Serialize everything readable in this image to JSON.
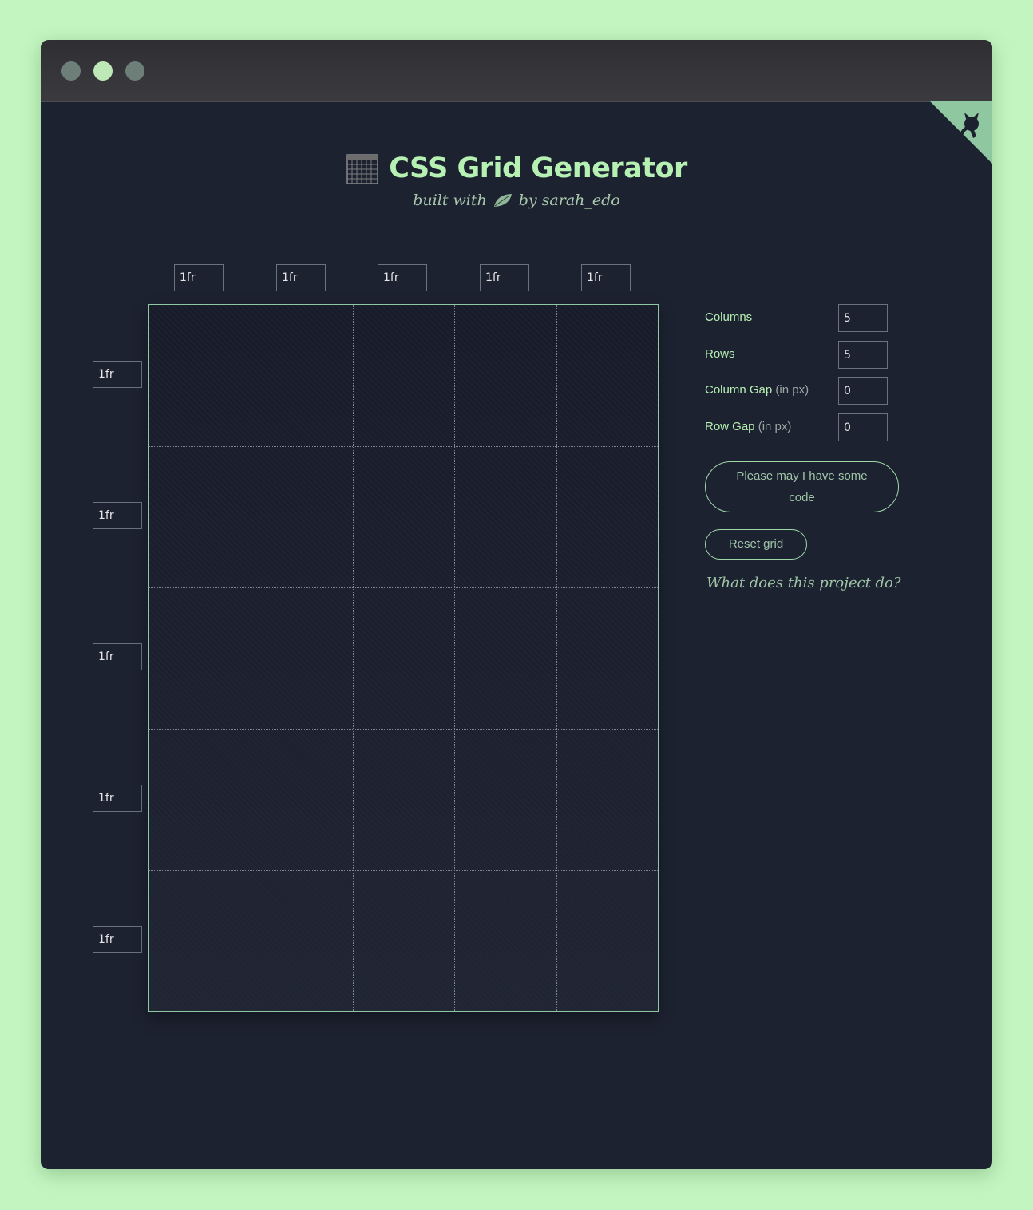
{
  "header": {
    "title": "CSS Grid Generator",
    "subtitle_prefix": "built with",
    "subtitle_suffix": "by sarah_edo"
  },
  "grid": {
    "columns": [
      "1fr",
      "1fr",
      "1fr",
      "1fr",
      "1fr"
    ],
    "rows": [
      "1fr",
      "1fr",
      "1fr",
      "1fr",
      "1fr"
    ]
  },
  "controls": {
    "columns_label": "Columns",
    "columns_value": "5",
    "rows_label": "Rows",
    "rows_value": "5",
    "column_gap_label": "Column Gap",
    "column_gap_unit": "(in px)",
    "column_gap_value": "0",
    "row_gap_label": "Row Gap",
    "row_gap_unit": "(in px)",
    "row_gap_value": "0"
  },
  "buttons": {
    "code": "Please may I have some code",
    "reset": "Reset grid"
  },
  "about_link": "What does this project do?",
  "icons": {
    "title": "grid-icon",
    "leaf": "leaf-icon",
    "corner": "github-octocat-icon"
  },
  "colors": {
    "background": "#c3f5c0",
    "window": "#1d2231",
    "accent": "#b6f0b2",
    "border": "#9fd9a8"
  }
}
